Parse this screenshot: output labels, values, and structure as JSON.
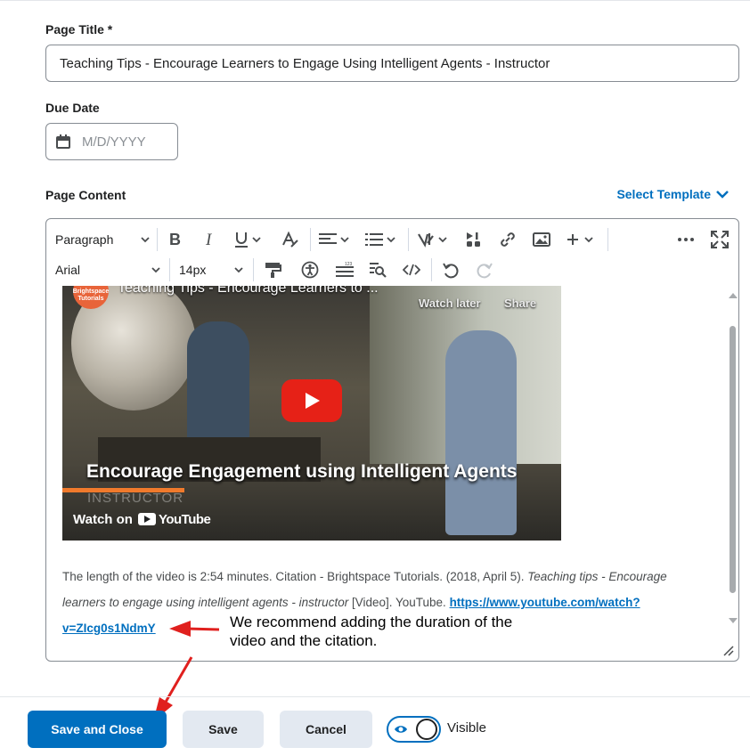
{
  "form": {
    "page_title_label": "Page Title *",
    "page_title_value": "Teaching Tips - Encourage Learners to Engage Using Intelligent Agents - Instructor",
    "due_date_label": "Due Date",
    "due_date_placeholder": "M/D/YYYY",
    "page_content_label": "Page Content",
    "select_template": "Select Template"
  },
  "toolbar": {
    "block_format": "Paragraph",
    "font_family": "Arial",
    "font_size": "14px",
    "icons_row1": [
      "bold-icon",
      "italic-icon",
      "underline-icon",
      "text-color-icon",
      "align-icon",
      "list-icon",
      "insert-stuff-icon",
      "media-icon",
      "link-icon",
      "image-icon",
      "plus-icon",
      "more-icon",
      "fullscreen-icon"
    ],
    "icons_row2": [
      "format-painter-icon",
      "accessibility-icon",
      "word-count-icon",
      "find-replace-icon",
      "source-code-icon",
      "undo-icon",
      "redo-icon"
    ]
  },
  "video": {
    "channel": "Brightspace Tutorials",
    "title": "Teaching Tips - Encourage Learners to ...",
    "watch_later": "Watch later",
    "share": "Share",
    "headline": "Encourage Engagement using Intelligent Agents",
    "subtitle": "INSTRUCTOR",
    "watch_on": "Watch on",
    "youtube": "YouTube"
  },
  "content": {
    "text_1": "The length of the video is 2:54 minutes. Citation - Brightspace Tutorials. (2018, April 5). ",
    "text_italic": "Teaching tips - Encourage learners to engage using intelligent agents - instructor",
    "text_2": " [Video]. YouTube. ",
    "link": "https://www.youtube.com/watch?v=ZIcg0s1NdmY"
  },
  "annotation": {
    "line1": "We recommend adding the duration of the",
    "line2": "video and the citation."
  },
  "footer": {
    "save_and_close": "Save and Close",
    "save": "Save",
    "cancel": "Cancel",
    "visible": "Visible"
  },
  "colors": {
    "primary": "#006fbf",
    "secondary_button": "#e3e9f1",
    "annotation_arrow": "#e0201e"
  }
}
